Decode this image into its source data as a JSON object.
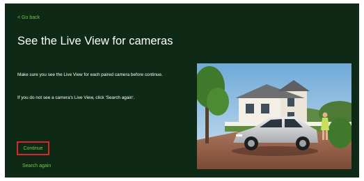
{
  "navigation": {
    "back_label": "< Go back"
  },
  "page": {
    "title": "See the Live View for cameras",
    "instruction": "Make sure you see the Live View for each paired camera before continue.",
    "hint": "If you do not see a camera's Live View, click 'Search again'."
  },
  "actions": {
    "continue_label": "Continue",
    "search_again_label": "Search again"
  },
  "colors": {
    "background": "#0e2a16",
    "accent": "#74c44c",
    "highlight_border": "#d8262c",
    "text": "#ffffff"
  }
}
